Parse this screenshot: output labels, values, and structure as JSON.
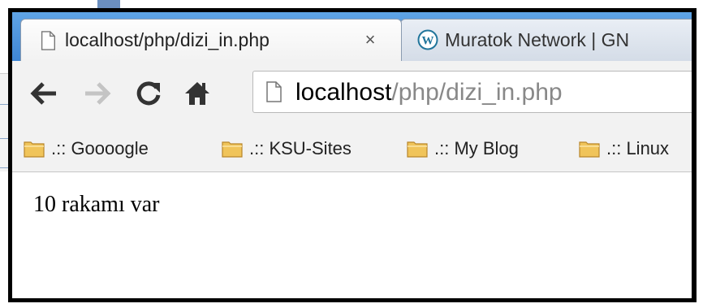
{
  "browser": {
    "tabs": [
      {
        "title": "localhost/php/dizi_in.php",
        "active": true,
        "close_label": "×"
      },
      {
        "title": "Muratok Network | GN",
        "active": false
      }
    ],
    "omnibox": {
      "host": "localhost",
      "path": "/php/dizi_in.php"
    },
    "bookmarks": [
      {
        "label": ".:: Goooogle"
      },
      {
        "label": ".:: KSU-Sites"
      },
      {
        "label": ".:: My Blog"
      },
      {
        "label": ".:: Linux"
      }
    ],
    "colors": {
      "tabstrip": "#3f86d4",
      "toolbar": "#f2f2f2",
      "folder": "#f0c45a"
    }
  },
  "page": {
    "body_text": "10 rakamı var"
  }
}
